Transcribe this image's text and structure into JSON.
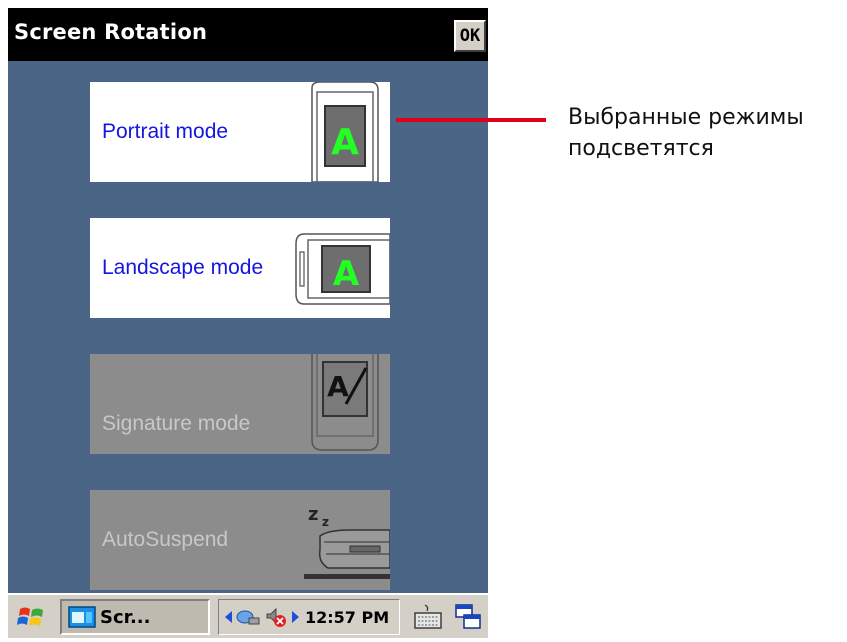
{
  "window": {
    "title": "Screen Rotation",
    "ok_label": "OK"
  },
  "modes": [
    {
      "label": "Portrait mode",
      "state": "selected",
      "icon": "portrait-device-icon"
    },
    {
      "label": "Landscape mode",
      "state": "selected",
      "icon": "landscape-device-icon"
    },
    {
      "label": "Signature mode",
      "state": "disabled",
      "icon": "signature-device-icon"
    },
    {
      "label": "AutoSuspend",
      "state": "disabled",
      "icon": "sleep-printer-icon"
    }
  ],
  "taskbar": {
    "task_label": "Scr...",
    "clock": "12:57 PM",
    "icons": [
      "windows-start-icon",
      "app-window-icon",
      "network-icon",
      "volume-muted-icon",
      "keyboard-icon",
      "switch-windows-icon"
    ]
  },
  "annotation": {
    "line1": "Выбранные режимы",
    "line2": "подсветятся"
  },
  "colors": {
    "selected_bg": "#ffffff",
    "selected_text": "#1515e0",
    "disabled_bg": "#8c8c8c",
    "disabled_text": "#c8c8c8",
    "content_bg": "#4a6586",
    "callout_line": "#e0001a"
  }
}
